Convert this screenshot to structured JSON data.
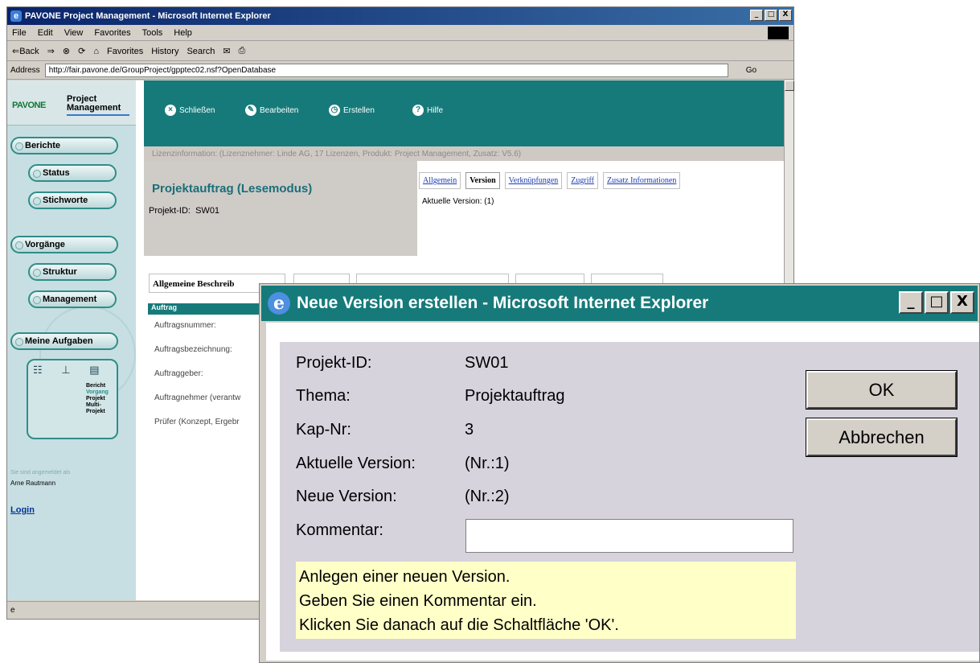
{
  "browser": {
    "title": "PAVONE Project Management - Microsoft Internet Explorer",
    "menu": [
      "File",
      "Edit",
      "View",
      "Favorites",
      "Tools",
      "Help"
    ],
    "toolbar": {
      "back": "⇐Back",
      "forward": "⇒",
      "favorites": "Favorites",
      "history": "History",
      "search": "Search"
    },
    "address_label": "Address",
    "address_value": "http://fair.pavone.de/GroupProject/gpptec02.nsf?OpenDatabase",
    "go_label": "Go",
    "window_buttons": [
      "_",
      "□",
      "X"
    ]
  },
  "app": {
    "logo": "PAVONE",
    "product_line1": "Project",
    "product_line2": "Management",
    "nav": {
      "berichte": "Berichte",
      "status": "Status",
      "stichworte": "Stichworte",
      "vorgaenge": "Vorgänge",
      "struktur": "Struktur",
      "management": "Management",
      "meine_aufgaben": "Meine Aufgaben"
    },
    "mini_panel": {
      "bericht": "Bericht",
      "vorgang": "Vorgang",
      "projekt": "Projekt",
      "multi1": "Multi-",
      "multi2": "Projekt"
    },
    "logged_in_label": "Sie sind angemeldet als",
    "user_name": "Arne Rautmann",
    "login_link": "Login",
    "toolbar": {
      "schliessen": "Schließen",
      "bearbeiten": "Bearbeiten",
      "erstellen": "Erstellen",
      "hilfe": "Hilfe"
    },
    "license_info": "Lizenzinformation: (Lizenznehmer: Linde AG, 17 Lizenzen, Produkt: Project Management, Zusatz: V5.6)",
    "doc_title": "Projektauftrag",
    "doc_mode": "(Lesemodus)",
    "project_id_label": "Projekt-ID:",
    "project_id_value": "SW01",
    "tabs": [
      "Allgemein",
      "Version",
      "Verknüpfungen",
      "Zugriff",
      "Zusatz Informationen"
    ],
    "active_tab": "Version",
    "current_version_text": "Aktuelle Version: (1)",
    "inner_tab": "Allgemeine Beschreib",
    "section_header": "Auftrag",
    "fields": [
      "Auftragsnummer:",
      "Auftragsbezeichnung:",
      "Auftraggeber:",
      "Auftragnehmer (verantw",
      "Prüfer (Konzept, Ergebr"
    ]
  },
  "dialog": {
    "title": "Neue Version erstellen - Microsoft Internet Explorer",
    "rows": [
      {
        "label": "Projekt-ID:",
        "value": "SW01"
      },
      {
        "label": "Thema:",
        "value": "Projektauftrag"
      },
      {
        "label": "Kap-Nr:",
        "value": "3"
      },
      {
        "label": "Aktuelle Version:",
        "value": "(Nr.:1)"
      },
      {
        "label": "Neue Version:",
        "value": "(Nr.:2)"
      }
    ],
    "comment_label": "Kommentar:",
    "comment_value": "",
    "help_lines": [
      "Anlegen einer neuen Version.",
      "Geben Sie einen Kommentar ein.",
      "Klicken Sie danach auf die Schaltfläche 'OK'."
    ],
    "ok_label": "OK",
    "cancel_label": "Abbrechen"
  },
  "colors": {
    "teal": "#167a7a",
    "nav_bg": "#c7dfe2",
    "help_bg": "#ffffc8"
  }
}
